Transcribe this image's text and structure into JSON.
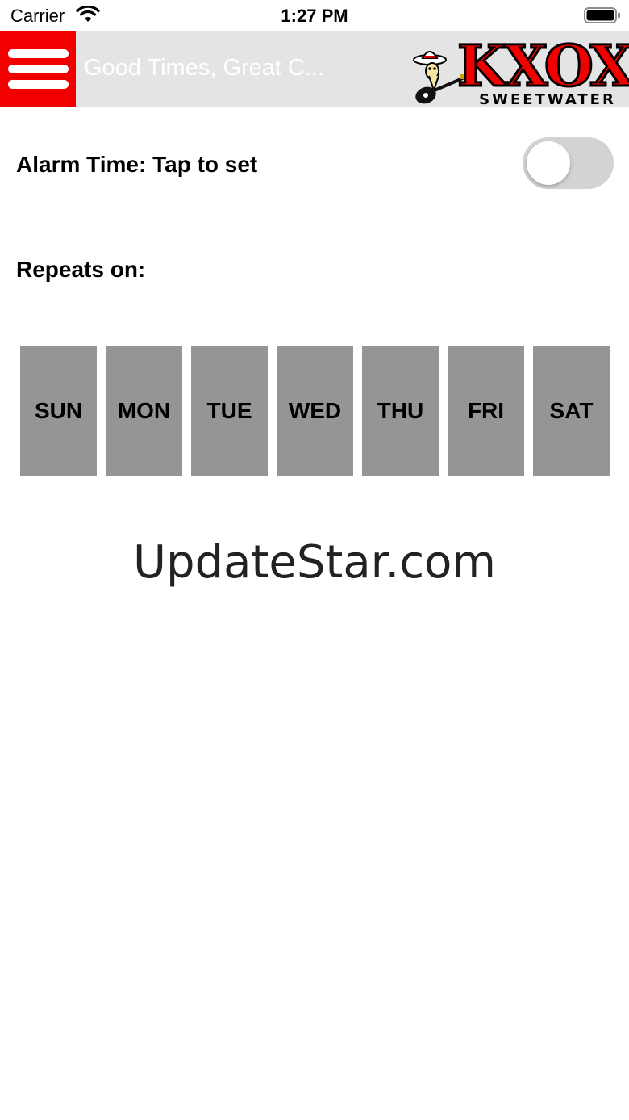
{
  "status_bar": {
    "carrier": "Carrier",
    "time": "1:27 PM",
    "icons": [
      "wifi-icon",
      "battery-icon"
    ]
  },
  "nav": {
    "menu_icon": "hamburger-menu-icon",
    "title": "Good Times, Great C...",
    "logo": {
      "text": "KXOX",
      "subtext": "SWEETWATER"
    }
  },
  "alarm": {
    "label": "Alarm Time: Tap to set",
    "enabled": false
  },
  "repeat": {
    "label": "Repeats on:",
    "days": [
      "SUN",
      "MON",
      "TUE",
      "WED",
      "THU",
      "FRI",
      "SAT"
    ]
  },
  "watermark": "UpdateStar.com",
  "colors": {
    "menu_red": "#f20000",
    "nav_bg": "#e4e4e4",
    "day_bg": "#959595",
    "toggle_off": "#d3d3d3"
  }
}
